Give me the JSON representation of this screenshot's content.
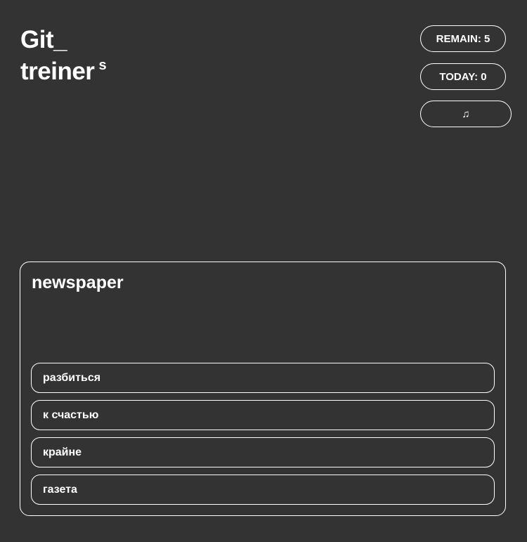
{
  "logo": {
    "line1": "Git_",
    "line2": "treiner",
    "superscript": "s"
  },
  "stats": {
    "remain_label": "REMAIN: 5",
    "today_label": "TODAY: 0",
    "music_label": "♫"
  },
  "card": {
    "word": "newspaper",
    "answers": [
      "разбиться",
      "к счастью",
      "крайне",
      "газета"
    ]
  },
  "colors": {
    "background": "#333333",
    "foreground": "#ffffff"
  }
}
